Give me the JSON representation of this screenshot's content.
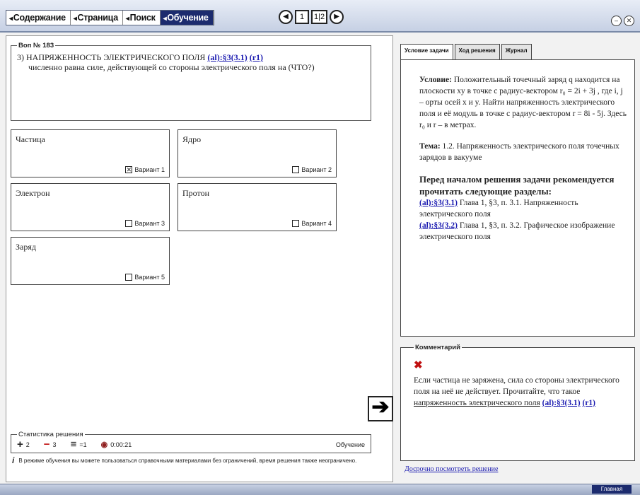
{
  "toolbar": {
    "menu": [
      "Содержание",
      "Страница",
      "Поиск",
      "Обучение"
    ],
    "pages": [
      "1",
      "1|2"
    ]
  },
  "question": {
    "legend": "Воп № 183",
    "title": "3) НАПРЯЖЕННОСТЬ ЭЛЕКТРИЧЕСКОГО ПОЛЯ",
    "link1": "(al):§3(3.1)",
    "link2": "(r1)",
    "text": "численно равна силе, действующей со стороны электрического поля на (ЧТО?)"
  },
  "options": [
    {
      "label": "Частица",
      "variant": "Вариант 1",
      "checked": true
    },
    {
      "label": "Ядро",
      "variant": "Вариант 2",
      "checked": false
    },
    {
      "label": "Электрон",
      "variant": "Вариант 3",
      "checked": false
    },
    {
      "label": "Протон",
      "variant": "Вариант 4",
      "checked": false
    },
    {
      "label": "Заряд",
      "variant": "Вариант 5",
      "checked": false
    }
  ],
  "stats": {
    "legend": "Статистика решения",
    "correct": "2",
    "wrong": "3",
    "equal": "=1",
    "time": "0:00:21",
    "mode": "Обучение"
  },
  "note": "В режиме обучения вы можете пользоваться справочными материалами без ограничений, время решения также неограничено.",
  "tabs": [
    "Условие задачи",
    "Ход решения",
    "Журнал"
  ],
  "task": {
    "condition_label": "Условие:",
    "condition_text": "Положительный точечный заряд q находится на плоскости xy в точке с радиус-вектором r₀ = 2i + 3j , где i, j – орты осей x и y. Найти напряженность электрического поля и её модуль в точке с радиус-вектором r = 8i - 5j. Здесь r₀ и r – в метрах.",
    "topic_label": "Тема:",
    "topic_text": "1.2. Напряженность электрического поля точечных зарядов в вакууме",
    "recommend": "Перед началом решения задачи рекомендуется прочитать следующие разделы:",
    "ref1_link": "(al):§3(3.1)",
    "ref1_text": "Глава 1, §3, п. 3.1. Напряженность электрического поля",
    "ref2_link": "(al):§3(3.2)",
    "ref2_text": "Глава 1, §3, п. 3.2. Графическое изображение электрического поля"
  },
  "comment": {
    "legend": "Комментарий",
    "text": "Если частица не заряжена, сила со стороны электрического поля на неё не действует. Прочитайте, что такое",
    "link_text": "напряженность электрического поля",
    "link1": "(al):§3(3.1)",
    "link2": "(r1)"
  },
  "show_solution": "Досрочно посмотреть решение",
  "home": "Главная"
}
